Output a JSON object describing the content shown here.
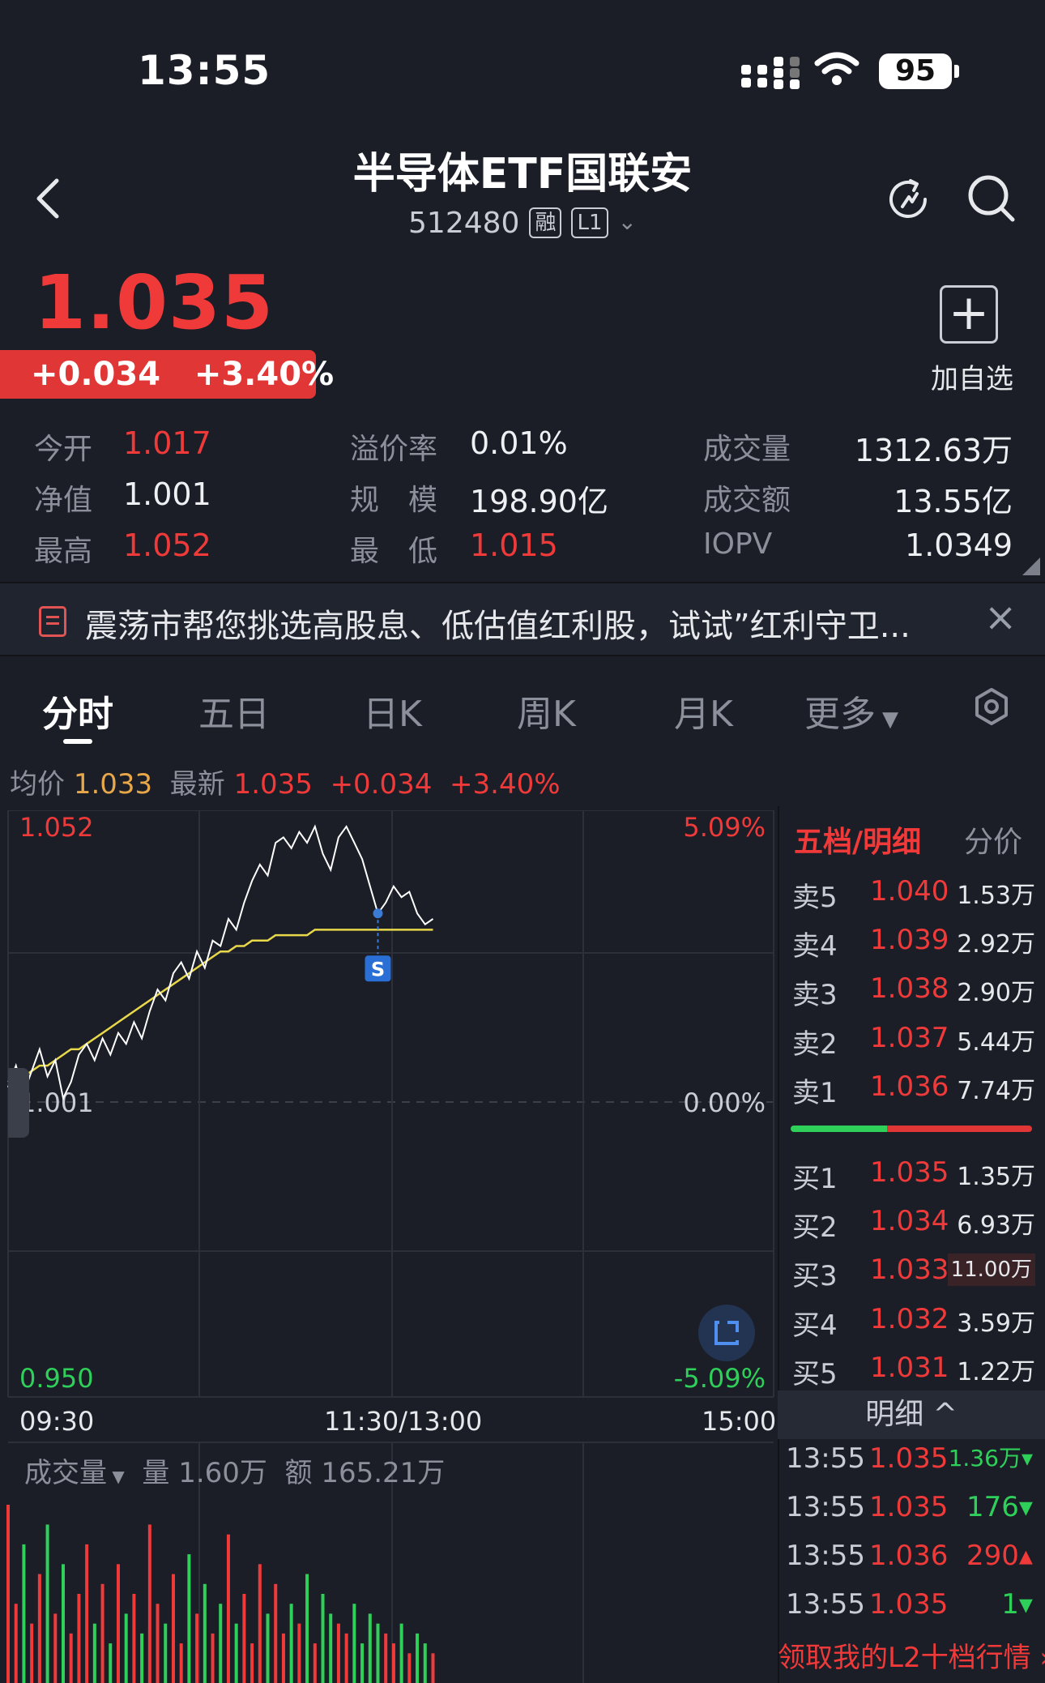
{
  "status_bar": {
    "time": "13:55",
    "battery": "95"
  },
  "header": {
    "title": "半导体ETF国联安",
    "code": "512480",
    "tag_margin": "融",
    "tag_level": "L1"
  },
  "quote": {
    "price": "1.035",
    "change": "+0.034",
    "change_pct": "+3.40%",
    "add_fav_label": "加自选"
  },
  "stats": [
    {
      "label": "今开",
      "value": "1.017"
    },
    {
      "label": "溢价率",
      "value": "0.01%"
    },
    {
      "label": "成交量",
      "value": "1312.63万"
    },
    {
      "label": "净值",
      "value": "1.001"
    },
    {
      "label": "规　模",
      "value": "198.90亿"
    },
    {
      "label": "成交额",
      "value": "13.55亿"
    },
    {
      "label": "最高",
      "value": "1.052"
    },
    {
      "label": "最　低",
      "value": "1.015"
    },
    {
      "label": "IOPV",
      "value": "1.0349"
    }
  ],
  "banner": {
    "text": "震荡市帮您挑选高股息、低估值红利股，试试”红利守卫..."
  },
  "tabs": [
    "分时",
    "五日",
    "日K",
    "周K",
    "月K",
    "更多"
  ],
  "chart_info": {
    "avg_label": "均价",
    "avg_value": "1.033",
    "latest_label": "最新",
    "latest_value": "1.035",
    "change": "+0.034",
    "change_pct": "+3.40%"
  },
  "chart_data": {
    "type": "line",
    "title": "",
    "y_left_ticks": [
      "1.052",
      "1.001",
      "0.950"
    ],
    "y_right_ticks": [
      "5.09%",
      "0.00%",
      "-5.09%"
    ],
    "ylim": [
      0.95,
      1.052
    ],
    "x_ticks": [
      "09:30",
      "11:30/13:00",
      "15:00"
    ],
    "marker_label": "S",
    "series": [
      {
        "name": "最新",
        "values": [
          1.004,
          1.008,
          1.003,
          1.007,
          1.011,
          1.006,
          1.009,
          1.002,
          1.005,
          1.01,
          1.012,
          1.009,
          1.013,
          1.01,
          1.014,
          1.012,
          1.016,
          1.013,
          1.018,
          1.022,
          1.02,
          1.025,
          1.027,
          1.024,
          1.029,
          1.026,
          1.031,
          1.03,
          1.035,
          1.033,
          1.038,
          1.042,
          1.045,
          1.043,
          1.049,
          1.05,
          1.048,
          1.051,
          1.049,
          1.052,
          1.047,
          1.044,
          1.05,
          1.052,
          1.049,
          1.046,
          1.041,
          1.036,
          1.038,
          1.041,
          1.039,
          1.04,
          1.036,
          1.034,
          1.035
        ]
      },
      {
        "name": "均价",
        "values": [
          1.005,
          1.006,
          1.006,
          1.007,
          1.008,
          1.008,
          1.009,
          1.01,
          1.011,
          1.011,
          1.012,
          1.013,
          1.014,
          1.015,
          1.016,
          1.017,
          1.018,
          1.019,
          1.02,
          1.021,
          1.022,
          1.023,
          1.024,
          1.025,
          1.026,
          1.027,
          1.028,
          1.029,
          1.029,
          1.03,
          1.03,
          1.031,
          1.031,
          1.031,
          1.032,
          1.032,
          1.032,
          1.032,
          1.032,
          1.033,
          1.033,
          1.033,
          1.033,
          1.033,
          1.033,
          1.033,
          1.033,
          1.033,
          1.033,
          1.033,
          1.033,
          1.033,
          1.033,
          1.033,
          1.033
        ]
      }
    ],
    "volume_bars": [
      90,
      40,
      70,
      30,
      55,
      80,
      35,
      60,
      25,
      45,
      70,
      30,
      50,
      20,
      60,
      35,
      45,
      25,
      80,
      40,
      30,
      55,
      20,
      65,
      35,
      50,
      25,
      40,
      75,
      30,
      45,
      20,
      60,
      35,
      50,
      25,
      40,
      30,
      55,
      20,
      45,
      35,
      30,
      25,
      40,
      20,
      35,
      30,
      25,
      20,
      30,
      15,
      25,
      20,
      15
    ]
  },
  "volume_info": {
    "label": "成交量",
    "vol_label": "量",
    "vol_value": "1.60万",
    "amt_label": "额",
    "amt_value": "165.21万"
  },
  "order_book": {
    "title": "五档/明细",
    "tab_fenjia": "分价",
    "asks": [
      {
        "label": "卖5",
        "price": "1.040",
        "vol": "1.53万"
      },
      {
        "label": "卖4",
        "price": "1.039",
        "vol": "2.92万"
      },
      {
        "label": "卖3",
        "price": "1.038",
        "vol": "2.90万"
      },
      {
        "label": "卖2",
        "price": "1.037",
        "vol": "5.44万"
      },
      {
        "label": "卖1",
        "price": "1.036",
        "vol": "7.74万"
      }
    ],
    "bids": [
      {
        "label": "买1",
        "price": "1.035",
        "vol": "1.35万"
      },
      {
        "label": "买2",
        "price": "1.034",
        "vol": "6.93万"
      },
      {
        "label": "买3",
        "price": "1.033",
        "vol": "11.00万"
      },
      {
        "label": "买4",
        "price": "1.032",
        "vol": "3.59万"
      },
      {
        "label": "买5",
        "price": "1.031",
        "vol": "1.22万"
      }
    ],
    "buy_ratio": 0.4,
    "detail_label": "明细 ^",
    "ticks": [
      {
        "time": "13:55",
        "price": "1.035",
        "vol": "1.36万",
        "dir": "down"
      },
      {
        "time": "13:55",
        "price": "1.035",
        "vol": "176",
        "dir": "down"
      },
      {
        "time": "13:55",
        "price": "1.036",
        "vol": "290",
        "dir": "up"
      },
      {
        "time": "13:55",
        "price": "1.035",
        "vol": "1",
        "dir": "down"
      }
    ],
    "promo": "领取我的L2十档行情 ›"
  },
  "colors": {
    "up": "#f03a3a",
    "down": "#2fd05a",
    "avg_line": "#e8d84a",
    "price_line": "#ffffff",
    "bg": "#1b1e27"
  }
}
